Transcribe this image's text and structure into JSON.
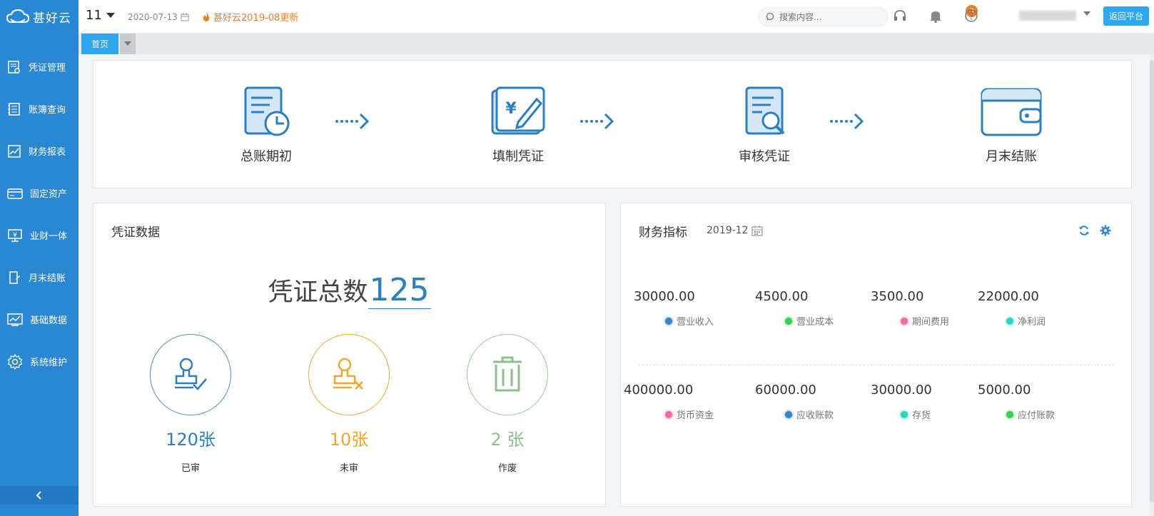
{
  "app": {
    "logo_text": "甚好云"
  },
  "sidebar": {
    "items": [
      {
        "label": "凭证管理",
        "icon": "voucher-icon"
      },
      {
        "label": "账簿查询",
        "icon": "ledger-icon"
      },
      {
        "label": "财务报表",
        "icon": "report-icon"
      },
      {
        "label": "固定资产",
        "icon": "asset-icon"
      },
      {
        "label": "业财一体",
        "icon": "integration-icon"
      },
      {
        "label": "月末结账",
        "icon": "month-close-icon"
      },
      {
        "label": "基础数据",
        "icon": "chart-icon"
      },
      {
        "label": "系统维护",
        "icon": "gear-icon"
      }
    ]
  },
  "topbar": {
    "period": "11",
    "date": "2020-07-13",
    "update_text": "甚好云2019-08更新",
    "search_placeholder": "搜索内容...",
    "notifications": "3",
    "return_label": "返回平台"
  },
  "tabs": {
    "home": "首页"
  },
  "flow": {
    "steps": [
      "总账期初",
      "填制凭证",
      "审核凭证",
      "月末结账"
    ]
  },
  "voucher": {
    "title": "凭证数据",
    "total_label": "凭证总数",
    "total": "125",
    "stats": [
      {
        "value": "120张",
        "label": "已审",
        "color": "#2a7fc3"
      },
      {
        "value": "10张",
        "label": "未审",
        "color": "#f5a623"
      },
      {
        "value": "2 张",
        "label": "作废",
        "color": "#8cc08c"
      }
    ]
  },
  "finance": {
    "title": "财务指标",
    "period": "2019-12",
    "metrics": [
      {
        "value": "30000.00",
        "label": "营业收入",
        "color": "#3b82c8"
      },
      {
        "value": "4500.00",
        "label": "营业成本",
        "color": "#34d058"
      },
      {
        "value": "3500.00",
        "label": "期间费用",
        "color": "#f06ba5"
      },
      {
        "value": "22000.00",
        "label": "净利润",
        "color": "#2ad6c0"
      },
      {
        "value": "400000.00",
        "label": "货币资金",
        "color": "#f06ba5"
      },
      {
        "value": "60000.00",
        "label": "应收账款",
        "color": "#3b82c8"
      },
      {
        "value": "30000.00",
        "label": "存货",
        "color": "#2ad6c0"
      },
      {
        "value": "5000.00",
        "label": "应付账款",
        "color": "#34d058"
      }
    ]
  }
}
